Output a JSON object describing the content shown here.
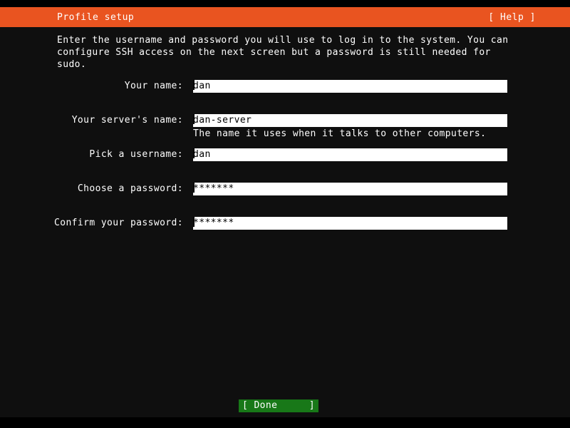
{
  "window": {
    "title": "Profile setup"
  },
  "header": {
    "title": "Profile setup",
    "help_label": "[ Help ]"
  },
  "intro": {
    "text": "Enter the username and password you will use to log in to the system. You can configure SSH access on the next screen but a password is still needed for sudo."
  },
  "form": {
    "fields": [
      {
        "label": "Your name:",
        "value": "dan",
        "hint": "",
        "masked": false
      },
      {
        "label": "Your server's name:",
        "value": "dan-server",
        "hint": "The name it uses when it talks to other computers.",
        "masked": false
      },
      {
        "label": "Pick a username:",
        "value": "dan",
        "hint": "",
        "masked": false
      },
      {
        "label": "Choose a password:",
        "value": "*******",
        "hint": "",
        "masked": true
      },
      {
        "label": "Confirm your password:",
        "value": "*******",
        "hint": "",
        "masked": true
      }
    ]
  },
  "footer": {
    "done_left": "[ Done",
    "done_right": "]"
  },
  "colors": {
    "accent_orange": "#e95420",
    "background": "#0f0f0f",
    "letterbox": "#000000",
    "input_background": "#ffffff",
    "button_green": "#187818",
    "text": "#ffffff"
  }
}
